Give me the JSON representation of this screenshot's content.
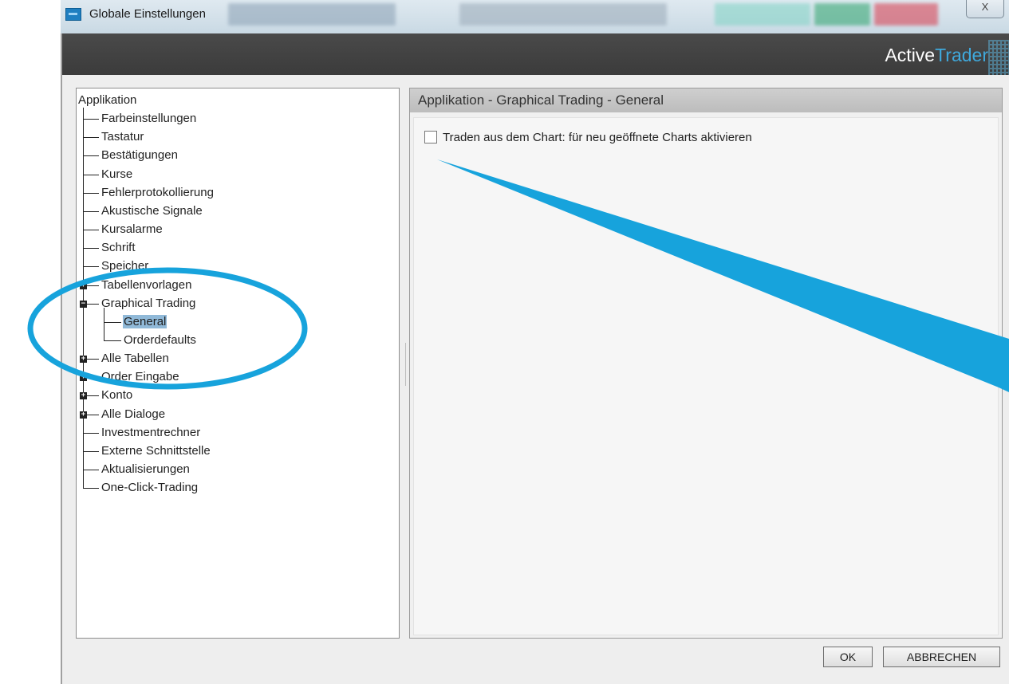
{
  "window": {
    "title": "Globale Einstellungen",
    "close_label": "X"
  },
  "header": {
    "brand_prefix": "Active",
    "brand_suffix": "Trader"
  },
  "tree": {
    "root": "Applikation",
    "items": [
      {
        "label": "Farbeinstellungen"
      },
      {
        "label": "Tastatur"
      },
      {
        "label": "Bestätigungen"
      },
      {
        "label": "Kurse"
      },
      {
        "label": "Fehlerprotokollierung"
      },
      {
        "label": "Akustische Signale"
      },
      {
        "label": "Kursalarme"
      },
      {
        "label": "Schrift"
      },
      {
        "label": "Speicher"
      },
      {
        "label": "Tabellenvorlagen",
        "expander": "+"
      },
      {
        "label": "Graphical Trading",
        "expander": "−"
      },
      {
        "label": "General",
        "child": true,
        "selected": true
      },
      {
        "label": "Orderdefaults",
        "child": true
      },
      {
        "label": "Alle Tabellen",
        "expander": "+"
      },
      {
        "label": "Order Eingabe",
        "expander": "+"
      },
      {
        "label": "Konto",
        "expander": "+"
      },
      {
        "label": "Alle Dialoge",
        "expander": "+"
      },
      {
        "label": "Investmentrechner"
      },
      {
        "label": "Externe Schnittstelle"
      },
      {
        "label": "Aktualisierungen"
      },
      {
        "label": "One-Click-Trading"
      }
    ]
  },
  "content": {
    "header": "Applikation - Graphical Trading - General",
    "checkbox_label": "Traden aus dem Chart: für neu geöffnete Charts aktivieren",
    "checkbox_checked": false
  },
  "buttons": {
    "ok": "OK",
    "cancel": "ABBRECHEN"
  },
  "colors": {
    "annotation": "#17a3dc",
    "selection": "#90b9d8",
    "header_bar": "#3f3f3f",
    "brand_accent": "#3fa9dc"
  }
}
